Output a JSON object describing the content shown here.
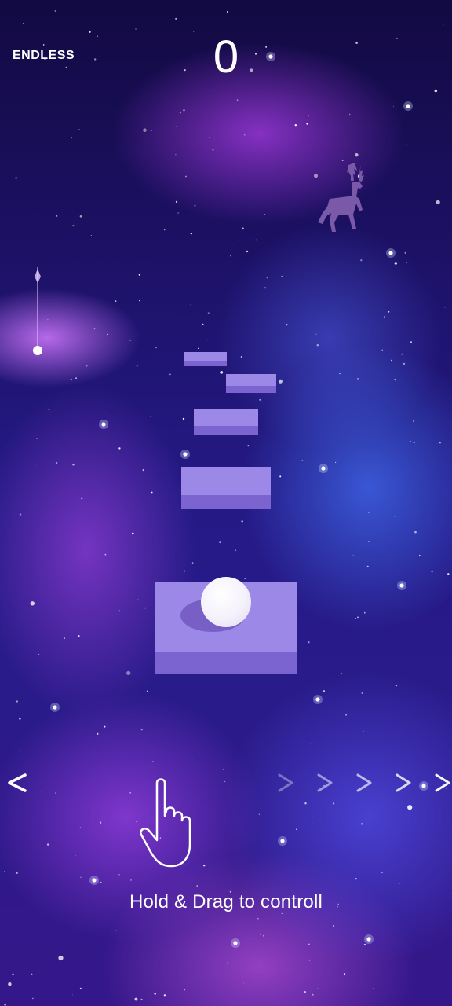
{
  "hud": {
    "mode_label": "ENDLESS",
    "score": "0"
  },
  "hint": {
    "text": "Hold & Drag to controll",
    "left_arrow": "<",
    "right_chevron_count": 5
  },
  "colors": {
    "tile_top": "#9c88e6",
    "tile_side": "#7b64d0",
    "ball": "#ffffff",
    "deer": "#7a5aa8"
  },
  "icons": {
    "deer": "deer-icon",
    "hand": "hand-pointer-icon",
    "hanging_orb": "hanging-orb-icon"
  }
}
